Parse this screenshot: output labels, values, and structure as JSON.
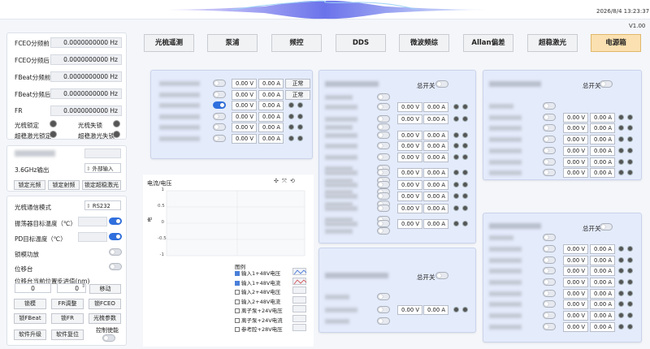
{
  "window": {
    "title": "",
    "datetime": "2026/8/4 13:23:37",
    "version": "V1.00"
  },
  "tabs": [
    {
      "label": "光梳遥测",
      "active": false
    },
    {
      "label": "泵浦",
      "active": false
    },
    {
      "label": "频控",
      "active": false
    },
    {
      "label": "DDS",
      "active": false
    },
    {
      "label": "微波频综",
      "active": false
    },
    {
      "label": "Allan偏差",
      "active": false
    },
    {
      "label": "超稳激光",
      "active": false
    },
    {
      "label": "电源箱",
      "active": true
    }
  ],
  "left": {
    "freq_rows": [
      {
        "label": "FCEO分频前",
        "value": "0.0000000000 Hz"
      },
      {
        "label": "FCEO分频后",
        "value": "0.0000000000 Hz"
      },
      {
        "label": "FBeat分频前",
        "value": "0.0000000000 Hz"
      },
      {
        "label": "FBeat分频后",
        "value": "0.0000000000 Hz"
      },
      {
        "label": "FR",
        "value": "0.0000000000 Hz"
      }
    ],
    "lock_status": [
      {
        "label": "光梳锁定"
      },
      {
        "label": "光梳失锁"
      },
      {
        "label": "超稳激光锁定"
      },
      {
        "label": "超稳激光失锁"
      }
    ],
    "sec2": {
      "output_label": "3.6GHz输出",
      "external_input": "外部输入",
      "buttons": [
        "锁定光频",
        "锁定射频",
        "锁定超稳激光"
      ]
    },
    "sec3": {
      "comm_mode_label": "光梳通信模式",
      "comm_mode_value": "RS232",
      "rows": [
        {
          "label": "振荡器目标温度（℃）",
          "on": true
        },
        {
          "label": "PD目标温度（℃）",
          "on": true
        },
        {
          "label": "锁模功放",
          "on": false
        },
        {
          "label": "位移台",
          "on": false
        }
      ],
      "pos_label": "位移台当前位置",
      "pos_value": "0",
      "step_label": "步进值(nm)",
      "step_value": "0",
      "move_button": "移动",
      "buttons": [
        "锁模",
        "FR调整",
        "锁FCEO",
        "锁FBeat",
        "锁FR",
        "光梳参数",
        "软件升级",
        "软件复位"
      ],
      "control_enable": "控制使能"
    }
  },
  "card1": {
    "rows": [
      {
        "v": "0.00 V",
        "a": "0.00 A",
        "btn": "正常",
        "on": false
      },
      {
        "v": "0.00 V",
        "a": "0.00 A",
        "btn": "正常",
        "on": false
      },
      {
        "v": "0.00 V",
        "a": "0.00 A",
        "on": true
      },
      {
        "v": "0.00 V",
        "a": "0.00 A",
        "on": false
      },
      {
        "v": "0.00 V",
        "a": "0.00 A",
        "on": false
      },
      {
        "v": "0.00 V",
        "a": "0.00 A",
        "on": false
      }
    ]
  },
  "card2": {
    "switch_label": "总开关",
    "rows": [
      {
        "v": "0.00 V",
        "a": "0.00 A"
      },
      {
        "v": "0.00 V",
        "a": "0.00 A"
      },
      {
        "v": "0.00 V",
        "a": "0.00 A"
      },
      {
        "v": "0.00 V",
        "a": "0.00 A"
      },
      {
        "v": "0.00 V",
        "a": "0.00 A"
      },
      {
        "v": "0.00 V",
        "a": "0.00 A"
      },
      {
        "v": "0.00 V",
        "a": "0.00 A"
      },
      {
        "v": "0.00 V",
        "a": "0.00 A"
      },
      {
        "v": "0.00 V",
        "a": "0.00 A"
      },
      {
        "v": "0.00 V",
        "a": "0.00 A"
      }
    ]
  },
  "card3": {
    "switch_label": "总开关",
    "rows": [
      {
        "v": "0.00 V",
        "a": "0.00 A"
      }
    ]
  },
  "card4": {
    "switch_label": "总开关",
    "rows": [
      {
        "v": "0.00 V",
        "a": "0.00 A"
      },
      {
        "v": "0.00 V",
        "a": "0.00 A"
      },
      {
        "v": "0.00 V",
        "a": "0.00 A"
      },
      {
        "v": "0.00 V",
        "a": "0.00 A"
      },
      {
        "v": "0.00 V",
        "a": "0.00 A"
      },
      {
        "v": "0.00 V",
        "a": "0.00 A"
      }
    ]
  },
  "card5": {
    "switch_label": "总开关",
    "rows": [
      {
        "v": "0.00 V",
        "a": "0.00 A"
      },
      {
        "v": "0.00 V",
        "a": "0.00 A"
      },
      {
        "v": "0.00 V",
        "a": "0.00 A"
      },
      {
        "v": "0.00 V",
        "a": "0.00 A"
      },
      {
        "v": "0.00 V",
        "a": "0.00 A"
      },
      {
        "v": "0.00 V",
        "a": "0.00 A"
      },
      {
        "v": "0.00 V",
        "a": "0.00 A"
      },
      {
        "v": "0.00 V",
        "a": "0.00 A"
      }
    ]
  },
  "chart": {
    "title": "电流/电压",
    "y_ticks": [
      "1",
      "0.5",
      "0",
      "-0.5",
      "-1"
    ],
    "legend_title": "图例",
    "legend": [
      {
        "label": "输入1+48V电压",
        "checked": true
      },
      {
        "label": "输入1+48V电流",
        "checked": true
      },
      {
        "label": "输入2+48V电压",
        "checked": false
      },
      {
        "label": "输入2+48V电流",
        "checked": false
      },
      {
        "label": "离子泵+24V电压",
        "checked": false
      },
      {
        "label": "离子泵+24V电流",
        "checked": false
      },
      {
        "label": "参考腔+28V电压",
        "checked": false
      }
    ]
  },
  "chart_data": {
    "type": "line",
    "title": "电流/电压",
    "xlabel": "",
    "ylabel": "",
    "ylim": [
      -1,
      1
    ],
    "y_ticks": [
      1,
      0.5,
      0,
      -0.5,
      -1
    ],
    "series": [],
    "legend_placement": "bottom-right",
    "grid": true
  }
}
